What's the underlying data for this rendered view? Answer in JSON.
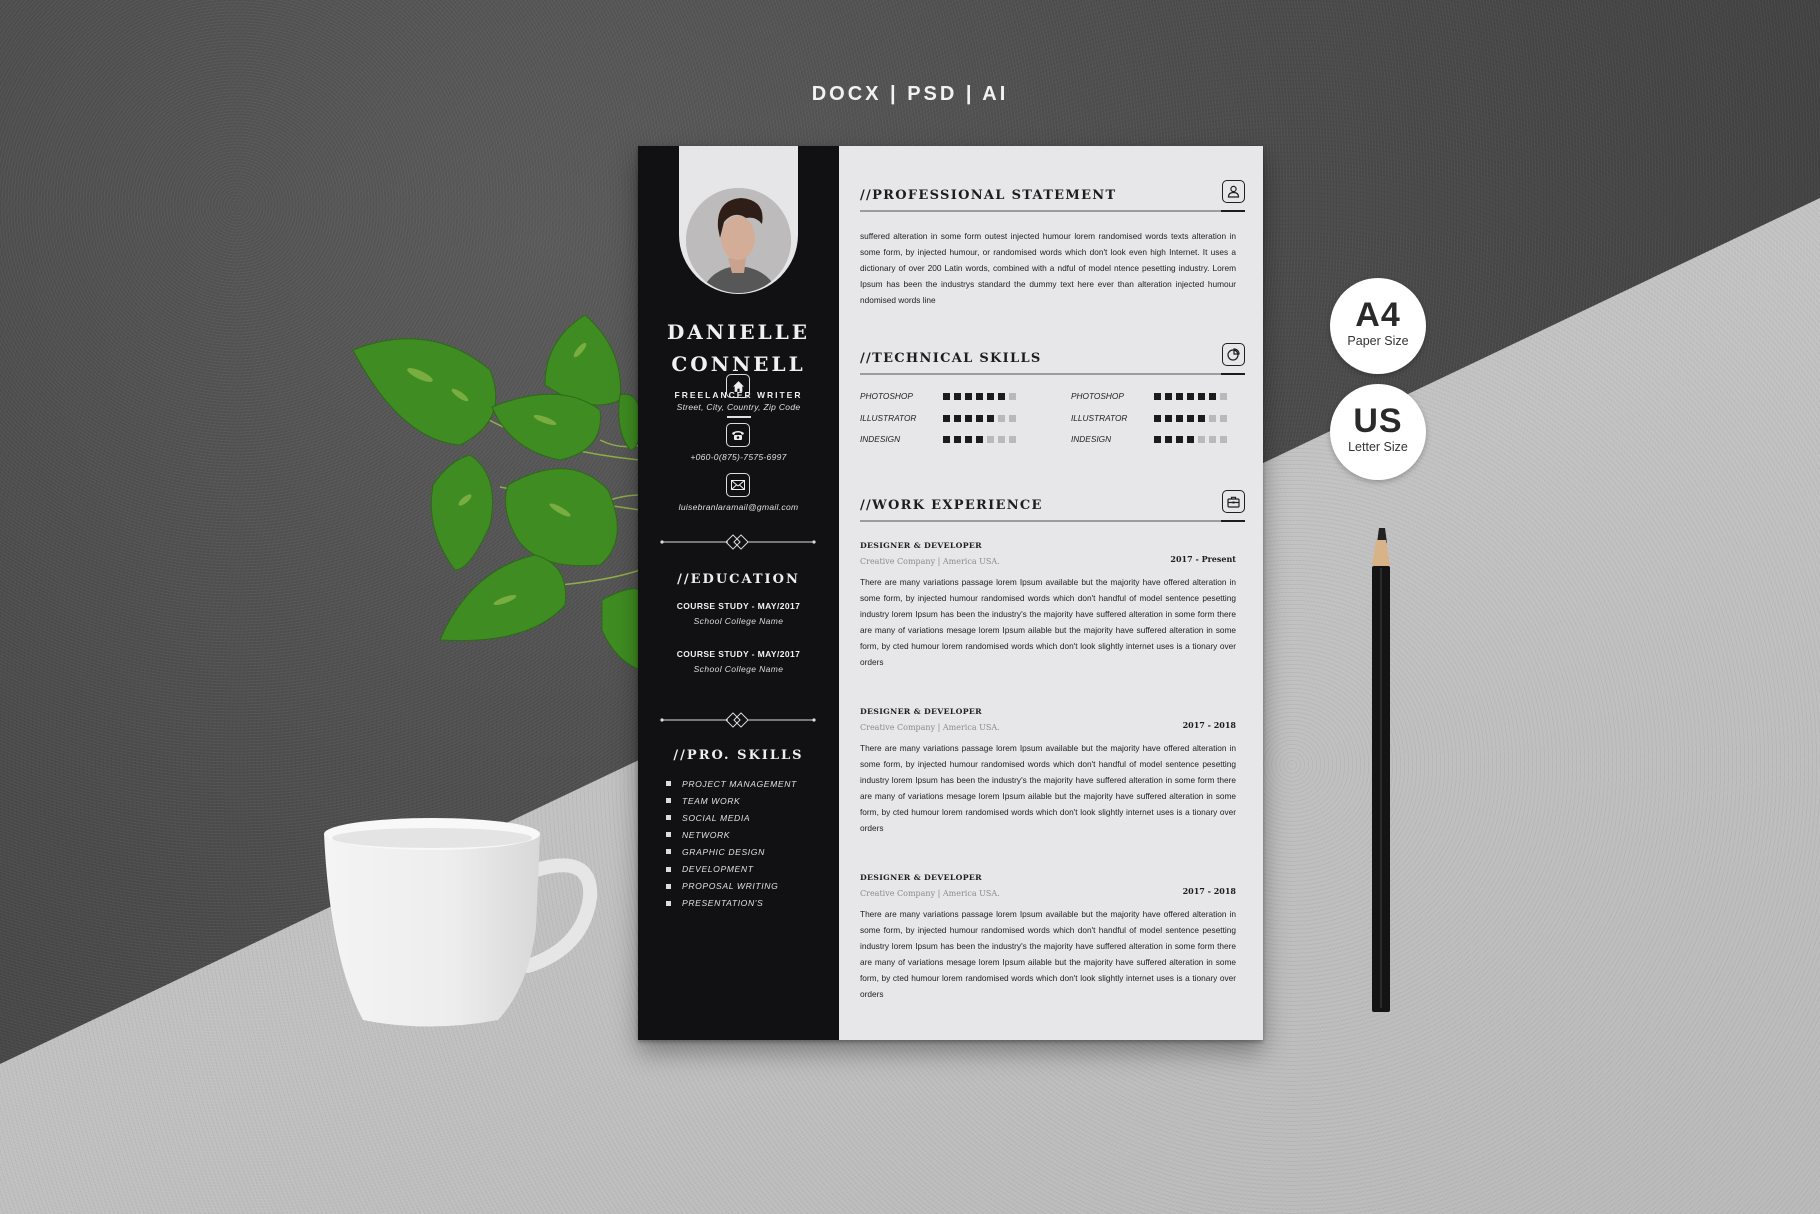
{
  "header": {
    "formats": "DOCX | PSD | AI"
  },
  "badges": [
    {
      "big": "A4",
      "small": "Paper Size"
    },
    {
      "big": "US",
      "small": "Letter Size"
    }
  ],
  "resume": {
    "first_name": "DANIELLE",
    "last_name": "CONNELL",
    "job_title": "FREELANCER WRITER",
    "contacts": [
      {
        "icon": "home-icon",
        "text": "Street, City, Country, Zip Code"
      },
      {
        "icon": "phone-icon",
        "text": "+060-0(875)-7575-6997"
      },
      {
        "icon": "mail-icon",
        "text": "luisebranlaramail@gmail.com"
      }
    ],
    "education": {
      "heading": "//EDUCATION",
      "items": [
        {
          "title": "COURSE STUDY - MAY/2017",
          "school": "School College Name"
        },
        {
          "title": "COURSE STUDY - MAY/2017",
          "school": "School College Name"
        }
      ]
    },
    "pro_skills": {
      "heading": "//PRO. SKILLS",
      "items": [
        "PROJECT MANAGEMENT",
        "TEAM WORK",
        "SOCIAL MEDIA",
        "NETWORK",
        "GRAPHIC DESIGN",
        "DEVELOPMENT",
        "PROPOSAL WRITING",
        "PRESENTATION'S"
      ]
    },
    "professional_statement": {
      "heading": "//PROFESSIONAL STATEMENT",
      "text": "suffered alteration in some form outest injected humour lorem randomised words texts alteration in some form, by injected humour, or randomised words which don't look even high Internet. It uses a dictionary of over 200 Latin words, combined with a ndful of model ntence pesetting industry. Lorem Ipsum has been the industrys standard the dummy text here ever than alteration injected humour ndomised words line"
    },
    "technical_skills": {
      "heading": "//TECHNICAL SKILLS",
      "max_level": 7,
      "columns": [
        [
          {
            "name": "PHOTOSHOP",
            "level": 6
          },
          {
            "name": "ILLUSTRATOR",
            "level": 5
          },
          {
            "name": "INDESIGN",
            "level": 4
          }
        ],
        [
          {
            "name": "PHOTOSHOP",
            "level": 6
          },
          {
            "name": "ILLUSTRATOR",
            "level": 5
          },
          {
            "name": "INDESIGN",
            "level": 4
          }
        ]
      ]
    },
    "work_experience": {
      "heading": "//WORK EXPERIENCE",
      "jobs": [
        {
          "title": "DESIGNER & DEVELOPER",
          "company": "Creative Company | America USA.",
          "dates": "2017 - Present",
          "description": "There are many variations passage lorem Ipsum available but the majority have offered alteration in some form, by injected humour randomised words which don't handful of model sentence pesetting industry lorem Ipsum has been the industry's the majority have suffered alteration in some form there are many of variations mesage lorem Ipsum ailable but the majority have suffered alteration in some form, by cted humour lorem randomised words which don't look slightly internet uses is a tionary over orders"
        },
        {
          "title": "DESIGNER & DEVELOPER",
          "company": "Creative Company | America USA.",
          "dates": "2017 - 2018",
          "description": "There are many variations passage lorem Ipsum available but the majority have offered alteration in some form, by injected humour randomised words which don't handful of model sentence pesetting industry lorem Ipsum has been the industry's the majority have suffered alteration in some form there are many of variations mesage lorem Ipsum ailable but the majority have suffered alteration in some form, by cted humour lorem randomised words which don't look slightly internet uses is a tionary over orders"
        },
        {
          "title": "DESIGNER & DEVELOPER",
          "company": "Creative Company | America USA.",
          "dates": "2017 - 2018",
          "description": "There are many variations passage lorem Ipsum available but the majority have offered alteration in some form, by injected humour randomised words which don't handful of model sentence pesetting industry lorem Ipsum has been the industry's the majority have suffered alteration in some form there are many of variations mesage lorem Ipsum ailable but the majority have suffered alteration in some form, by cted humour lorem randomised words which don't look slightly internet uses is a tionary over orders"
        }
      ]
    }
  },
  "colors": {
    "sidebar": "#111113",
    "paper": "#e7e6e8",
    "skill_on": "#1c1c1c",
    "skill_off": "#b9b9b9"
  }
}
